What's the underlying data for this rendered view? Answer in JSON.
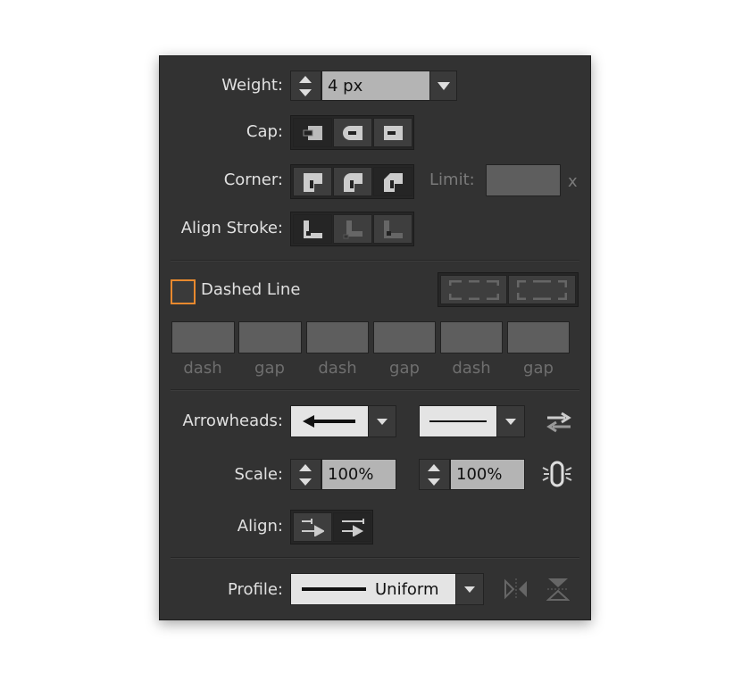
{
  "weight": {
    "label": "Weight:",
    "value": "4 px"
  },
  "cap": {
    "label": "Cap:",
    "options": [
      "butt-cap",
      "round-cap",
      "projecting-cap"
    ],
    "selected": 0
  },
  "corner": {
    "label": "Corner:",
    "options": [
      "miter-join",
      "round-join",
      "bevel-join"
    ],
    "selected": 2,
    "limit_label": "Limit:",
    "limit_value": "",
    "limit_suffix": "x"
  },
  "align_stroke": {
    "label": "Align Stroke:",
    "options": [
      "center",
      "inside",
      "outside"
    ],
    "selected": 0
  },
  "dashed": {
    "label": "Dashed Line",
    "checked": false,
    "accent": "#e8892e",
    "fields": [
      {
        "label": "dash",
        "value": ""
      },
      {
        "label": "gap",
        "value": ""
      },
      {
        "label": "dash",
        "value": ""
      },
      {
        "label": "gap",
        "value": ""
      },
      {
        "label": "dash",
        "value": ""
      },
      {
        "label": "gap",
        "value": ""
      }
    ]
  },
  "arrowheads": {
    "label": "Arrowheads:",
    "start": "arrow-left",
    "end": "none"
  },
  "scale": {
    "label": "Scale:",
    "start": "100%",
    "end": "100%"
  },
  "align": {
    "label": "Align:",
    "selected": 1
  },
  "profile": {
    "label": "Profile:",
    "value": "Uniform"
  }
}
